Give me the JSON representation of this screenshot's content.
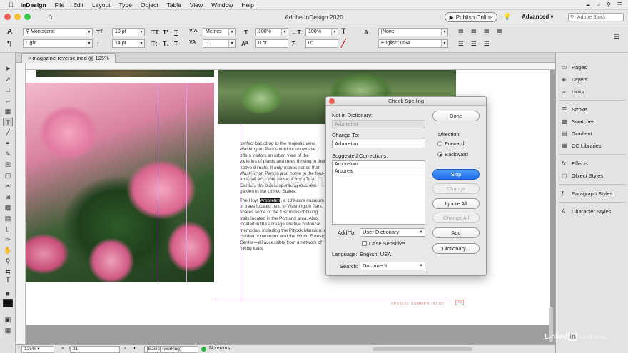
{
  "menubar": {
    "apple": "",
    "items": [
      "InDesign",
      "File",
      "Edit",
      "Layout",
      "Type",
      "Object",
      "Table",
      "View",
      "Window",
      "Help"
    ]
  },
  "appbar": {
    "title": "Adobe InDesign 2020",
    "publish_label": "Publish Online",
    "workspace": "Advanced",
    "stock_placeholder": "Adobe Stock"
  },
  "control": {
    "font_family": "Montserrat",
    "font_style": "Light",
    "font_size": "10 pt",
    "leading": "14 pt",
    "kerning": "Metrics",
    "tracking": "0",
    "vscale": "100%",
    "hscale": "100%",
    "baseline": "0 pt",
    "skew": "0°",
    "char_style": "[None]",
    "language": "English: USA"
  },
  "document": {
    "tab_label": "magazine-reverse.indd @ 125%",
    "paragraph1": "perfect backdrop to the majestic view. Washington Park's outdoor showcase offers visitors an urban view of the varieties of plants and trees thriving in their native climate. It only makes sense that Washington Park is also home to the four-and-half-acre International Rose Test Garden, the oldest operating rose test garden in the United States.",
    "paragraph2_before": "The Hoyt ",
    "paragraph2_highlight": "Arboretim",
    "paragraph2_after": ", a 189-acre museum of trees located next to Washington Park, shares some of the 152 miles of hiking trails located in the Portland area. Also located in the acreage are five historical memorials including the Pittock Mansion, a children's museum, and the World Forestry Center—all accessible from a network of hiking trails.",
    "footer": "SPECIAL SUMMER ISSUE",
    "footer_page": "76"
  },
  "watermark": "0xr.com",
  "dialog": {
    "title": "Check Spelling",
    "not_in_dict_label": "Not in Dictionary:",
    "not_in_dict_value": "Arboretim",
    "change_to_label": "Change To:",
    "change_to_value": "Arboretim",
    "suggested_label": "Suggested Corrections:",
    "suggestions": [
      "Arboretum",
      "Arboreal"
    ],
    "add_to_label": "Add To:",
    "add_to_value": "User Dictionary",
    "case_sensitive_label": "Case Sensitive",
    "language_label": "Language:",
    "language_value": "English: USA",
    "search_label": "Search:",
    "search_value": "Document",
    "direction_label": "Direction",
    "forward_label": "Forward",
    "backward_label": "Backward",
    "buttons": {
      "done": "Done",
      "skip": "Skip",
      "change": "Change",
      "ignore_all": "Ignore All",
      "change_all": "Change All",
      "add": "Add",
      "dictionary": "Dictionary..."
    }
  },
  "panels": [
    {
      "icon": "pages-icon",
      "label": "Pages"
    },
    {
      "icon": "layers-icon",
      "label": "Layers"
    },
    {
      "icon": "links-icon",
      "label": "Links"
    },
    {
      "icon": "stroke-icon",
      "label": "Stroke"
    },
    {
      "icon": "swatches-icon",
      "label": "Swatches"
    },
    {
      "icon": "gradient-icon",
      "label": "Gradient"
    },
    {
      "icon": "cc-libraries-icon",
      "label": "CC Libraries"
    },
    {
      "icon": "effects-icon",
      "label": "Effects"
    },
    {
      "icon": "object-styles-icon",
      "label": "Object Styles"
    },
    {
      "icon": "paragraph-styles-icon",
      "label": "Paragraph Styles"
    },
    {
      "icon": "character-styles-icon",
      "label": "Character Styles"
    }
  ],
  "status": {
    "zoom": "125%",
    "page": "31",
    "style": "[Basic] (working)",
    "preflight": "No errors"
  },
  "branding": {
    "linked": "Linked",
    "in": "in",
    "learning": "LEARNING"
  },
  "colors": {
    "accent_blue": "#1e6de5",
    "preflight_green": "#2db24a",
    "close_red": "#f25f58"
  }
}
